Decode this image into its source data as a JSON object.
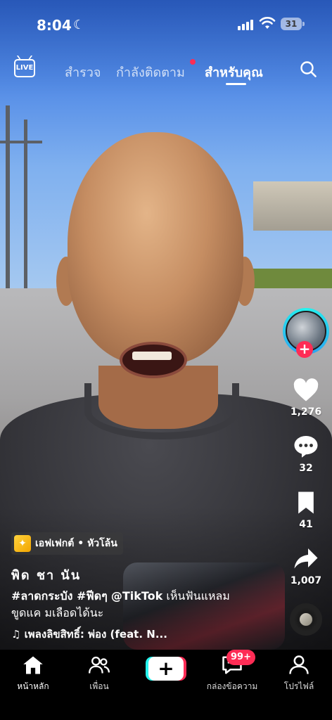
{
  "status_bar": {
    "time": "8:04",
    "battery": "31"
  },
  "top_nav": {
    "live_label": "LIVE",
    "tabs": [
      {
        "label": "สำรวจ"
      },
      {
        "label": "กำลังติดตาม"
      },
      {
        "label": "สำหรับคุณ"
      }
    ],
    "active_tab": "สำหรับคุณ"
  },
  "actions": {
    "likes": "1,276",
    "comments": "32",
    "saves": "41",
    "shares": "1,007"
  },
  "post": {
    "effect_label": "เอฟเฟกต์ • หัวโล้น",
    "author": "พิด ชา นัน",
    "caption_tags": "#ลาดกระบัง #ฟีดๆ",
    "caption_mention": "@TikTok",
    "caption_text": "เห็นฟันแหลม",
    "caption_line2": "ขูดแค มเลือดได้นะ",
    "music": "♫ เพลงลิขสิทธิ์: พ่อง (feat. N..."
  },
  "bottom_nav": {
    "home": "หน้าหลัก",
    "friends": "เพื่อน",
    "inbox": "กล่องข้อความ",
    "inbox_badge": "99+",
    "profile": "โปรไฟล์"
  },
  "colors": {
    "accent_red": "#fe2c55",
    "accent_cyan": "#25f4ee"
  }
}
